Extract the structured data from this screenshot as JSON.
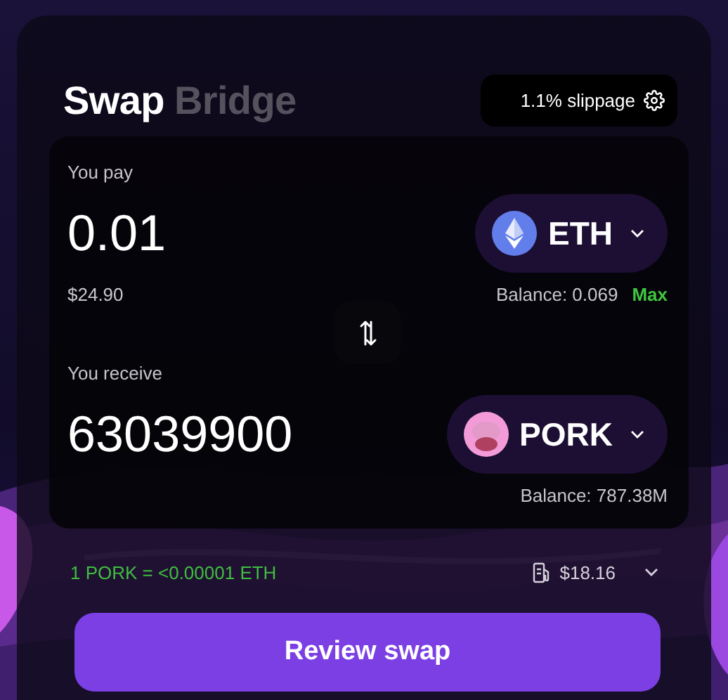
{
  "tabs": [
    {
      "label": "Swap",
      "selected": true
    },
    {
      "label": "Bridge",
      "selected": false
    }
  ],
  "slippage_button": {
    "label": "1.1% slippage"
  },
  "pay": {
    "label": "You pay",
    "amount": "0.01",
    "fiat_value": "$24.90",
    "token": {
      "symbol": "ETH",
      "kind": "eth"
    },
    "balance": "Balance: 0.069",
    "max_link": "Max"
  },
  "receive": {
    "label": "You receive",
    "amount": "63039900",
    "token": {
      "symbol": "PORK",
      "kind": "pork"
    },
    "balance": "Balance: 787.38M"
  },
  "rate": "1 PORK = <0.00001 ETH",
  "gas_fee": "$18.16",
  "primary_button": "Review swap"
}
